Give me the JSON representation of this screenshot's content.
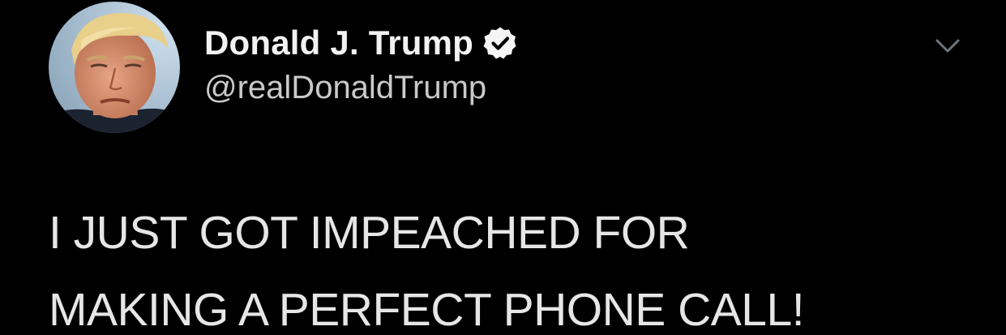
{
  "author": {
    "display_name": "Donald J. Trump",
    "handle": "@realDonaldTrump",
    "verified_icon": "verified-badge-icon",
    "avatar_icon": "avatar"
  },
  "menu": {
    "icon": "chevron-down-icon"
  },
  "tweet": {
    "lines": [
      "I JUST GOT IMPEACHED FOR",
      "MAKING A PERFECT PHONE CALL!"
    ]
  },
  "colors": {
    "background": "#000000",
    "name_text": "#f2f2f2",
    "handle_text": "#c9c9c9",
    "body_text": "#e6e6e6",
    "chevron": "#6e767d"
  }
}
